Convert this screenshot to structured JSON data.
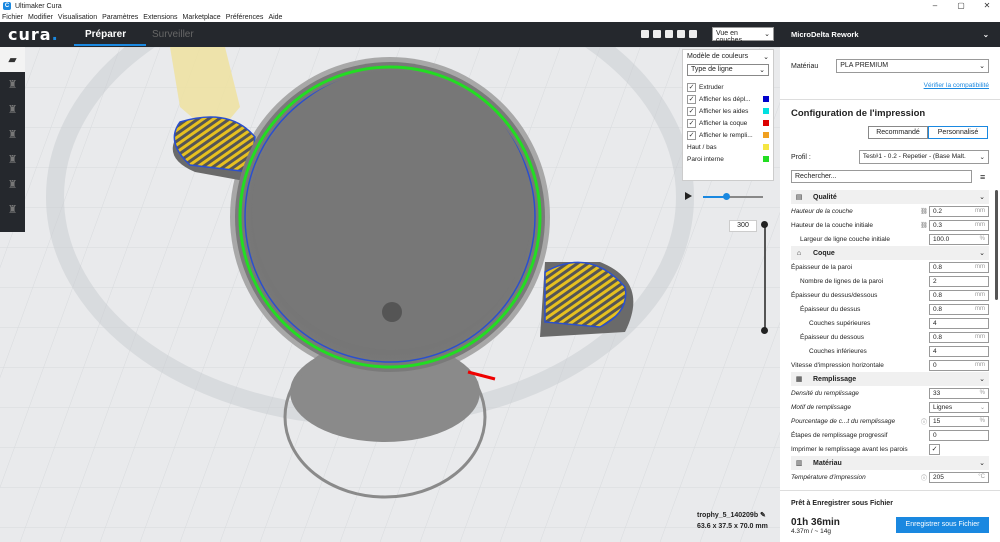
{
  "window": {
    "title": "Ultimaker Cura",
    "controls": [
      "–",
      "▢",
      "✕"
    ]
  },
  "menu": [
    "Fichier",
    "Modifier",
    "Visualisation",
    "Paramètres",
    "Extensions",
    "Marketplace",
    "Préférences",
    "Aide"
  ],
  "header": {
    "logo": "cura",
    "tabs": [
      {
        "label": "Préparer",
        "active": true
      },
      {
        "label": "Surveiller",
        "active": false
      }
    ],
    "view_select": "Vue en couches",
    "view_icons": [
      "cube-3d-icon",
      "cube-front-icon",
      "cube-top-icon",
      "cube-left-icon",
      "cube-right-icon"
    ]
  },
  "toolbar": {
    "items": [
      "open-folder-icon",
      "move-icon",
      "scale-icon",
      "rotate-icon",
      "mirror-icon",
      "per-model-settings-icon",
      "support-blocker-icon"
    ]
  },
  "color_panel": {
    "title": "Modèle de couleurs",
    "scheme": "Type de ligne",
    "items": [
      {
        "label": "Extruder",
        "checked": true,
        "color": ""
      },
      {
        "label": "Afficher les dépl...",
        "checked": true,
        "color": "#0000cc"
      },
      {
        "label": "Afficher les aides",
        "checked": true,
        "color": "#00e0e0"
      },
      {
        "label": "Afficher la coque",
        "checked": true,
        "color": "#dd0000"
      },
      {
        "label": "Afficher le rempli...",
        "checked": true,
        "color": "#f0a020"
      }
    ],
    "legend": [
      {
        "label": "Haut / bas",
        "color": "#f5e642"
      },
      {
        "label": "Paroi interne",
        "color": "#22dd22"
      }
    ]
  },
  "layer_slider": {
    "value": "300"
  },
  "object_info": {
    "name": "trophy_5_140209b",
    "dims": "63.6 x 37.5 x 70.0 mm"
  },
  "sidebar": {
    "printer": "MicroDelta Rework",
    "material_label": "Matériau",
    "material": "PLA PREMIUM",
    "compat_link": "Vérifier la compatibilité",
    "config_title": "Configuration de l'impression",
    "mode_buttons": [
      "Recommandé",
      "Personnalisé"
    ],
    "profile_label": "Profil :",
    "profile": "Test#1 - 0.2 - Repetier - (Base Malt. ",
    "search_placeholder": "Rechercher...",
    "settings": [
      {
        "type": "cat",
        "label": "Qualité",
        "icon": "quality-icon",
        "chev": "⌄"
      },
      {
        "type": "row",
        "label": "Hauteur de la couche",
        "italic": true,
        "indent": 0,
        "link": true,
        "value": "0.2",
        "unit": "mm"
      },
      {
        "type": "row",
        "label": "Hauteur de la couche initiale",
        "italic": false,
        "indent": 0,
        "link": true,
        "value": "0.3",
        "unit": "mm"
      },
      {
        "type": "row",
        "label": "Largeur de ligne couche initiale",
        "italic": false,
        "indent": 1,
        "value": "100.0",
        "unit": "%"
      },
      {
        "type": "cat",
        "label": "Coque",
        "icon": "shell-icon",
        "chev": "⌄"
      },
      {
        "type": "row",
        "label": "Épaisseur de la paroi",
        "italic": false,
        "indent": 0,
        "value": "0.8",
        "unit": "mm"
      },
      {
        "type": "row",
        "label": "Nombre de lignes de la paroi",
        "italic": false,
        "indent": 1,
        "value": "2",
        "unit": ""
      },
      {
        "type": "row",
        "label": "Épaisseur du dessus/dessous",
        "italic": false,
        "indent": 0,
        "value": "0.8",
        "unit": "mm"
      },
      {
        "type": "row",
        "label": "Épaisseur du dessus",
        "italic": false,
        "indent": 1,
        "value": "0.8",
        "unit": "mm"
      },
      {
        "type": "row",
        "label": "Couches supérieures",
        "italic": false,
        "indent": 2,
        "value": "4",
        "unit": ""
      },
      {
        "type": "row",
        "label": "Épaisseur du dessous",
        "italic": false,
        "indent": 1,
        "value": "0.8",
        "unit": "mm"
      },
      {
        "type": "row",
        "label": "Couches inférieures",
        "italic": false,
        "indent": 2,
        "value": "4",
        "unit": ""
      },
      {
        "type": "row",
        "label": "Vitesse d'impression horizontale",
        "italic": false,
        "indent": 0,
        "value": "0",
        "unit": "mm"
      },
      {
        "type": "cat",
        "label": "Remplissage",
        "icon": "infill-icon",
        "chev": "⌄"
      },
      {
        "type": "row",
        "label": "Densité du remplissage",
        "italic": true,
        "indent": 0,
        "value": "33",
        "unit": "%"
      },
      {
        "type": "row",
        "label": "Motif de remplissage",
        "italic": true,
        "indent": 0,
        "value": "Lignes",
        "unit": "⌄"
      },
      {
        "type": "row",
        "label": "Pourcentage de c...t du remplissage",
        "italic": true,
        "indent": 0,
        "info": true,
        "value": "15",
        "unit": "%"
      },
      {
        "type": "row",
        "label": "Étapes de remplissage progressif",
        "italic": false,
        "indent": 0,
        "value": "0",
        "unit": ""
      },
      {
        "type": "check",
        "label": "Imprimer le remplissage avant les parois",
        "checked": "✓"
      },
      {
        "type": "cat",
        "label": "Matériau",
        "icon": "material-icon",
        "chev": "⌄"
      },
      {
        "type": "row",
        "label": "Température d'impression",
        "italic": true,
        "indent": 0,
        "info": true,
        "value": "205",
        "unit": "°C"
      }
    ],
    "footer": {
      "title": "Prêt à Enregistrer sous Fichier",
      "time": "01h 36min",
      "usage": "4.37m / ~ 14g",
      "button": "Enregistrer sous Fichier"
    }
  }
}
